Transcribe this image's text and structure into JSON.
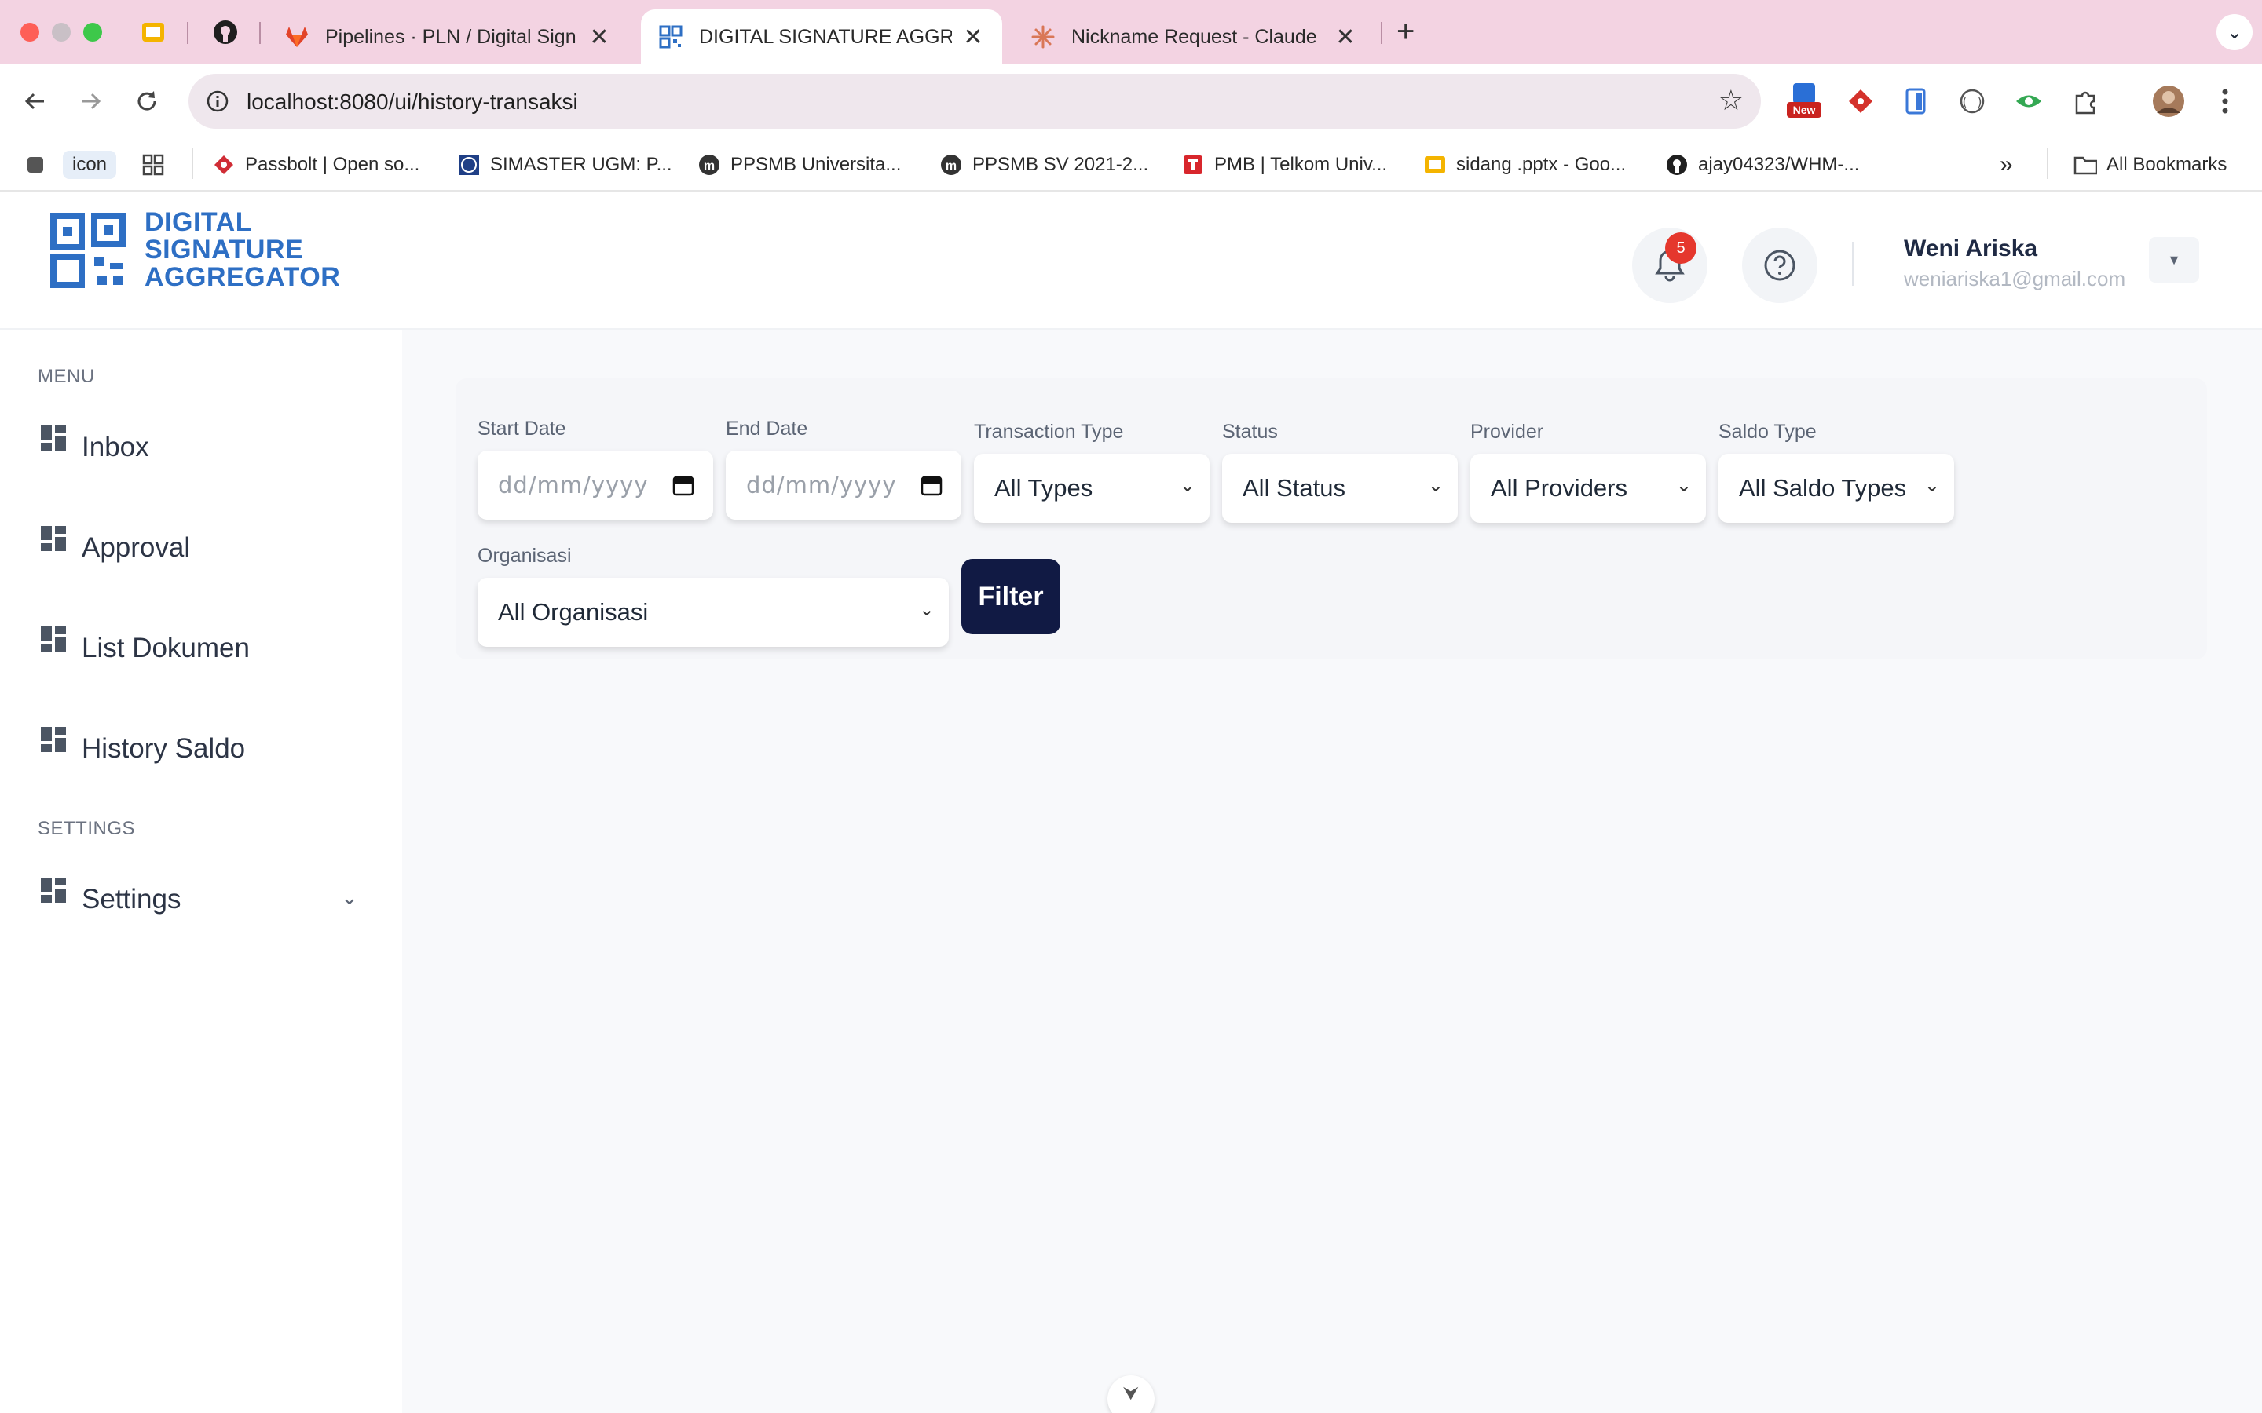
{
  "browser": {
    "tabs": [
      {
        "title": "Pipelines · PLN / Digital Sign /",
        "icon": "gitlab-icon"
      },
      {
        "title": "DIGITAL SIGNATURE AGGREGATOR",
        "icon": "dsa-qr-icon"
      },
      {
        "title": "Nickname Request - Claude",
        "icon": "claude-icon"
      }
    ],
    "url": "localhost:8080/ui/history-transaksi",
    "new_badge": "New",
    "bookmarks": [
      {
        "label": "icon"
      },
      {
        "label": "Passbolt | Open so..."
      },
      {
        "label": "SIMASTER UGM: P..."
      },
      {
        "label": "PPSMB Universita..."
      },
      {
        "label": "PPSMB SV 2021-2..."
      },
      {
        "label": "PMB | Telkom Univ..."
      },
      {
        "label": "sidang .pptx - Goo..."
      },
      {
        "label": "ajay04323/WHM-..."
      }
    ],
    "all_bookmarks": "All Bookmarks",
    "overflow": "»"
  },
  "app": {
    "logo": {
      "line1": "DIGITAL",
      "line2": "SIGNATURE",
      "line3": "AGGREGATOR"
    },
    "notifications_count": "5",
    "user": {
      "name": "Weni Ariska",
      "email": "weniariska1@gmail.com"
    }
  },
  "sidebar": {
    "menu_label": "MENU",
    "settings_label": "SETTINGS",
    "items": [
      {
        "label": "Inbox"
      },
      {
        "label": "Approval"
      },
      {
        "label": "List Dokumen"
      },
      {
        "label": "History Saldo"
      }
    ],
    "settings_item": {
      "label": "Settings"
    }
  },
  "filters": {
    "start_date": {
      "label": "Start Date",
      "placeholder": "dd/mm/yyyy"
    },
    "end_date": {
      "label": "End Date",
      "placeholder": "dd/mm/yyyy"
    },
    "transaction_type": {
      "label": "Transaction Type",
      "value": "All Types"
    },
    "status": {
      "label": "Status",
      "value": "All Status"
    },
    "provider": {
      "label": "Provider",
      "value": "All Providers"
    },
    "saldo_type": {
      "label": "Saldo Type",
      "value": "All Saldo Types"
    },
    "organisasi": {
      "label": "Organisasi",
      "value": "All Organisasi"
    },
    "filter_button": "Filter"
  },
  "colors": {
    "brand": "#2e6fc4",
    "filter_button": "#111a44",
    "badge": "#e5372d",
    "tabbar": "#f3d3e2"
  }
}
